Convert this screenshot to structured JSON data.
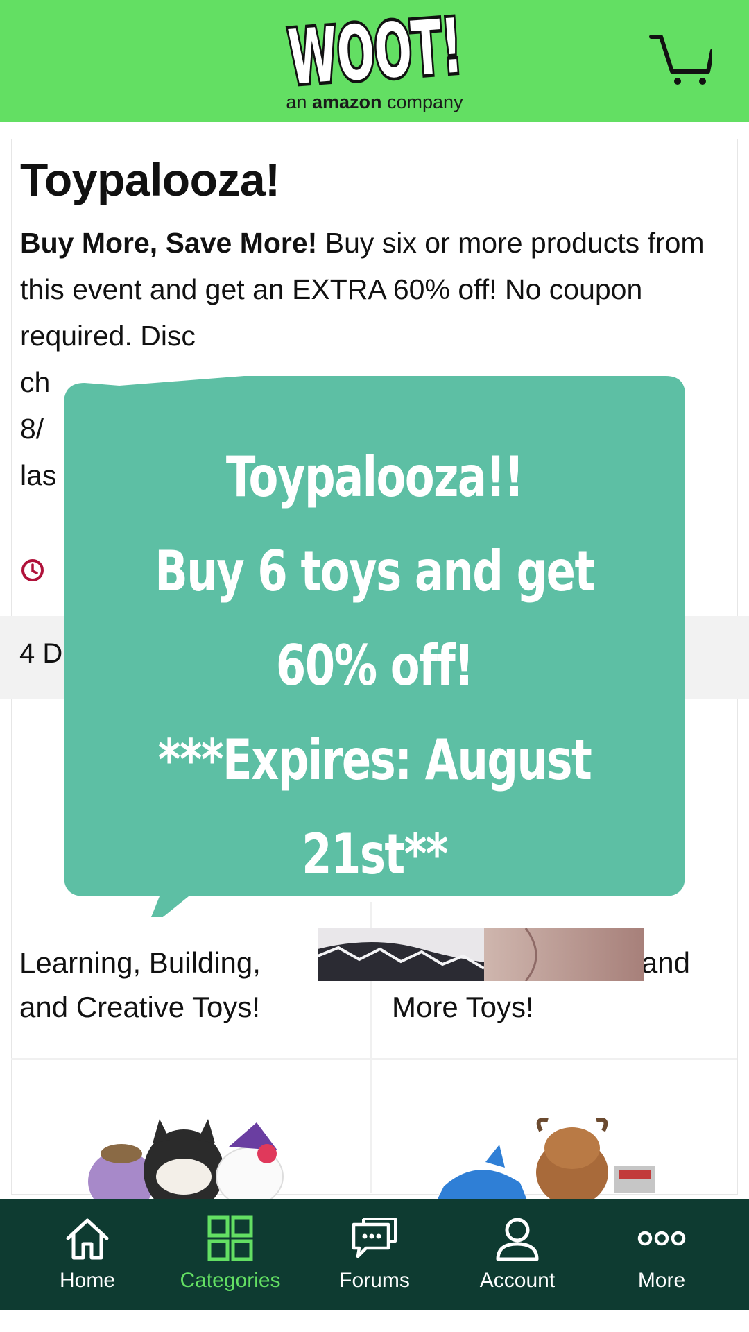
{
  "header": {
    "logo_text": "WOOT!",
    "tagline_prefix": "an",
    "tagline_brand": "amazon",
    "tagline_suffix": "company",
    "cart_icon": "cart-icon",
    "bg_color": "#63df63"
  },
  "event": {
    "title": "Toypalooza!",
    "desc_bold": "Buy More, Save More!",
    "desc_text": " Buy six or more products from this event and get an EXTRA 60% off! No coupon required. Disc",
    "line_fragments": [
      "ch",
      "8/",
      "las"
    ],
    "deals_count": "4 D"
  },
  "categories": {
    "left_label_1": "Learning, Building,",
    "left_label_2": "and Creative Toys!",
    "right_label_1": "and",
    "right_label_2": "More Toys!"
  },
  "overlay": {
    "line1": "Toypalooza!!",
    "line2": "Buy 6 toys and get",
    "line3": "60% off!",
    "line4": "***Expires: August",
    "line5": "21st**",
    "bubble_color": "#5dbfa4"
  },
  "nav": {
    "items": [
      {
        "label": "Home",
        "icon": "home-icon"
      },
      {
        "label": "Categories",
        "icon": "grid-icon"
      },
      {
        "label": "Forums",
        "icon": "forums-icon"
      },
      {
        "label": "Account",
        "icon": "account-icon"
      },
      {
        "label": "More",
        "icon": "more-icon"
      }
    ],
    "active": "Categories",
    "bg_color": "#0e3b31",
    "active_color": "#63df63"
  }
}
